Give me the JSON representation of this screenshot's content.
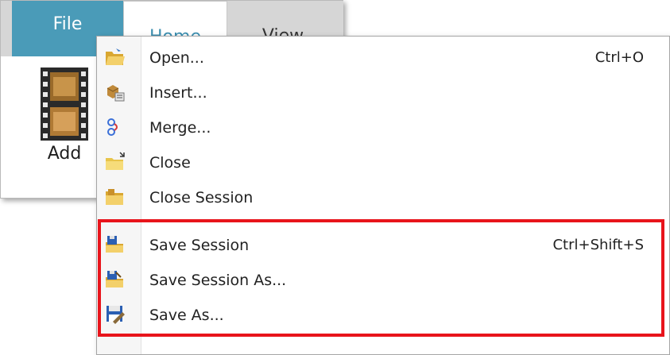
{
  "ribbon": {
    "tabs": [
      {
        "label": "File"
      },
      {
        "label": "Home"
      },
      {
        "label": "View"
      }
    ],
    "add_label": "Add"
  },
  "menu": {
    "items": [
      {
        "label": "Open...",
        "shortcut": "Ctrl+O",
        "icon": "open-folder-icon"
      },
      {
        "label": "Insert...",
        "shortcut": "",
        "icon": "insert-icon"
      },
      {
        "label": "Merge...",
        "shortcut": "",
        "icon": "merge-icon"
      },
      {
        "label": "Close",
        "shortcut": "",
        "icon": "close-folder-icon"
      },
      {
        "label": "Close Session",
        "shortcut": "",
        "icon": "close-session-icon"
      },
      {
        "label": "Save Session",
        "shortcut": "Ctrl+Shift+S",
        "icon": "save-session-icon"
      },
      {
        "label": "Save Session As...",
        "shortcut": "",
        "icon": "save-session-as-icon"
      },
      {
        "label": "Save As...",
        "shortcut": "",
        "icon": "save-as-icon"
      }
    ]
  },
  "colors": {
    "file_tab": "#4a9bb8",
    "highlight": "#e8141b"
  }
}
